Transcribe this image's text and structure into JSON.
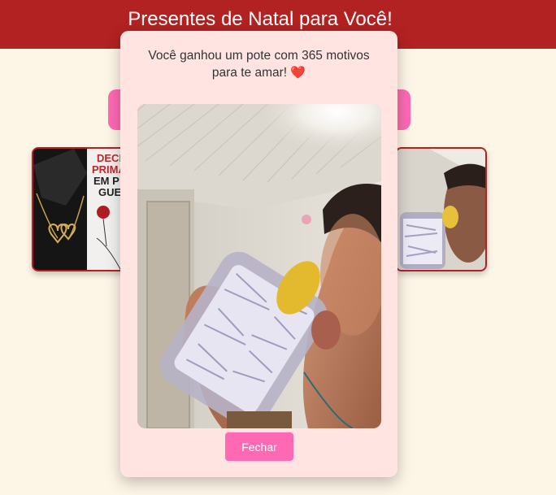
{
  "header": {
    "title": "Presentes de Natal para Você!"
  },
  "cards": [
    {
      "name": "necklace-photo",
      "print_text": "DECLA PRIMA EM P GUE"
    },
    {
      "name": "jar-photo-preview"
    }
  ],
  "modal": {
    "message": "Você ganhou um pote com 365 motivos para te amar!",
    "heart": "❤️",
    "close_label": "Fechar"
  },
  "colors": {
    "header_bg": "#b22222",
    "page_bg": "#fdf5e6",
    "accent_pink": "#ff69b4",
    "modal_bg": "#ffe4e1"
  }
}
